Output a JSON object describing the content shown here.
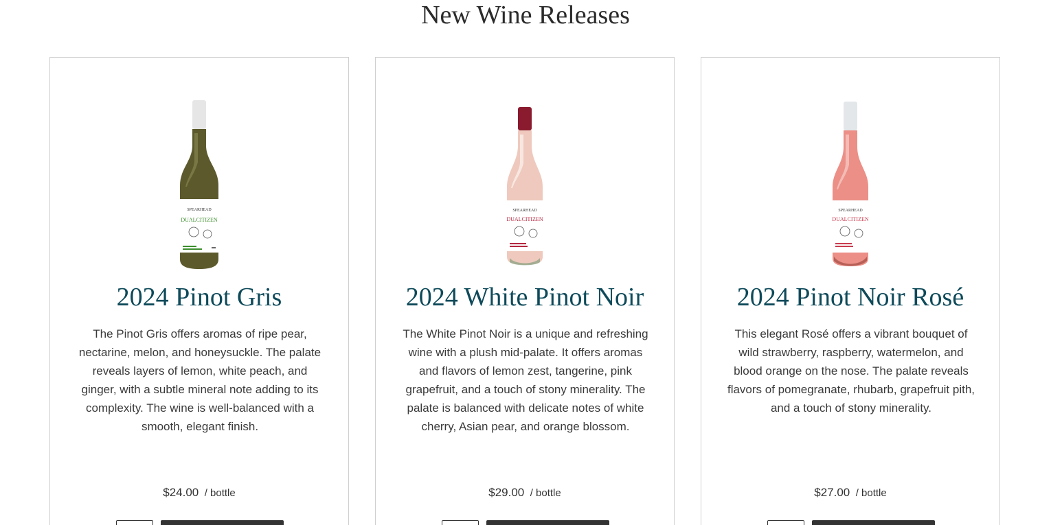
{
  "page": {
    "title": "New Wine Releases"
  },
  "products": [
    {
      "name": "2024 Pinot Gris",
      "description": "The Pinot Gris offers aromas of ripe pear, nectarine, melon, and honeysuckle. The palate reveals layers of lemon, white peach, and ginger, with a subtle mineral note adding to its complexity. The wine is well-balanced with a smooth, elegant finish.",
      "price": "$24.00",
      "unit": "/ bottle",
      "label_brand": "SPEARHEAD",
      "label_name": "DUALCITIZEN",
      "bottle_image": "white-wine-bottle",
      "colors": {
        "capsule": "#e6e6e6",
        "glass": "#5c5a2c",
        "label_accent": "#3d8f2e"
      }
    },
    {
      "name": "2024 White Pinot Noir",
      "description": "The White Pinot Noir is a unique and refreshing wine with a plush mid-palate. It offers aromas and flavors of lemon zest, tangerine, pink grapefruit, and a touch of stony minerality. The palate is balanced with delicate notes of white cherry, Asian pear, and orange blossom.",
      "price": "$29.00",
      "unit": "/ bottle",
      "label_brand": "SPEARHEAD",
      "label_name": "DUALCITIZEN",
      "bottle_image": "white-pinot-noir-bottle",
      "colors": {
        "capsule": "#8a1b2e",
        "glass": "#efc9bd",
        "label_accent": "#b2273f"
      }
    },
    {
      "name": "2024 Pinot Noir Rosé",
      "description": "This elegant Rosé offers a vibrant bouquet of wild strawberry, raspberry, watermelon, and blood orange on the nose. The palate reveals flavors of pomegranate, rhubarb, grapefruit pith, and a touch of stony minerality.",
      "price": "$27.00",
      "unit": "/ bottle",
      "label_brand": "SPEARHEAD",
      "label_name": "DUALCITIZEN",
      "bottle_image": "rose-wine-bottle",
      "colors": {
        "capsule": "#e3e7ea",
        "glass": "#ec8f86",
        "label_accent": "#c83c4f"
      }
    }
  ]
}
